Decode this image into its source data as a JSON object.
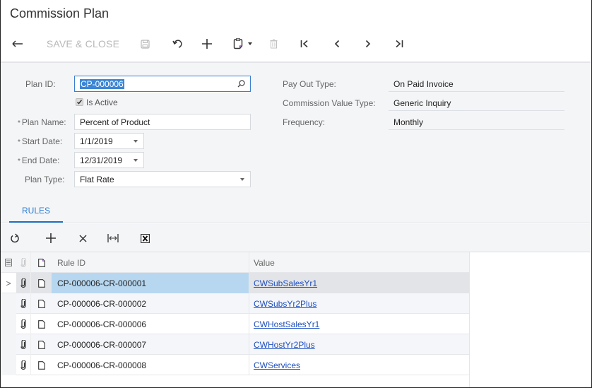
{
  "page": {
    "title": "Commission Plan"
  },
  "toolbar": {
    "back_icon": "back-arrow-icon",
    "save_close_label": "SAVE & CLOSE",
    "save_icon": "save-icon",
    "undo_icon": "undo-icon",
    "add_icon": "plus-icon",
    "copy_paste_icon": "clipboard-icon",
    "delete_icon": "trash-icon",
    "first_icon": "first-record-icon",
    "prev_icon": "previous-record-icon",
    "next_icon": "next-record-icon",
    "last_icon": "last-record-icon"
  },
  "form": {
    "plan_id": {
      "label": "Plan ID:",
      "value": "CP-000006"
    },
    "is_active": {
      "label": "Is Active",
      "checked": true
    },
    "plan_name": {
      "label": "Plan Name:",
      "value": "Percent of Product",
      "required": true
    },
    "start_date": {
      "label": "Start Date:",
      "value": "1/1/2019",
      "required": true
    },
    "end_date": {
      "label": "End Date:",
      "value": "12/31/2019",
      "required": true
    },
    "plan_type": {
      "label": "Plan Type:",
      "value": "Flat Rate"
    },
    "pay_out_type": {
      "label": "Pay Out Type:",
      "value": "On Paid Invoice"
    },
    "commission_value_type": {
      "label": "Commission Value Type:",
      "value": "Generic Inquiry"
    },
    "frequency": {
      "label": "Frequency:",
      "value": "Monthly"
    },
    "required_marker": "*"
  },
  "tabs": [
    {
      "label": "RULES",
      "active": true
    }
  ],
  "grid": {
    "toolbar": [
      "refresh-icon",
      "plus-icon",
      "close-icon",
      "fit-columns-icon",
      "excel-export-icon"
    ],
    "columns": {
      "rule_id": "Rule ID",
      "value": "Value"
    },
    "rows": [
      {
        "rule_id": "CP-000006-CR-000001",
        "value": "CWSubSalesYr1",
        "selected": true
      },
      {
        "rule_id": "CP-000006-CR-000002",
        "value": "CWSubsYr2Plus"
      },
      {
        "rule_id": "CP-000006-CR-000006",
        "value": "CWHostSalesYr1"
      },
      {
        "rule_id": "CP-000006-CR-000007",
        "value": "CWHostYr2Plus"
      },
      {
        "rule_id": "CP-000006-CR-000008",
        "value": "CWServices"
      }
    ],
    "row_indicator": ">"
  },
  "colors": {
    "accent": "#1a73c9",
    "link": "#1f4fbf",
    "selected_row": "#b7d7f0"
  }
}
